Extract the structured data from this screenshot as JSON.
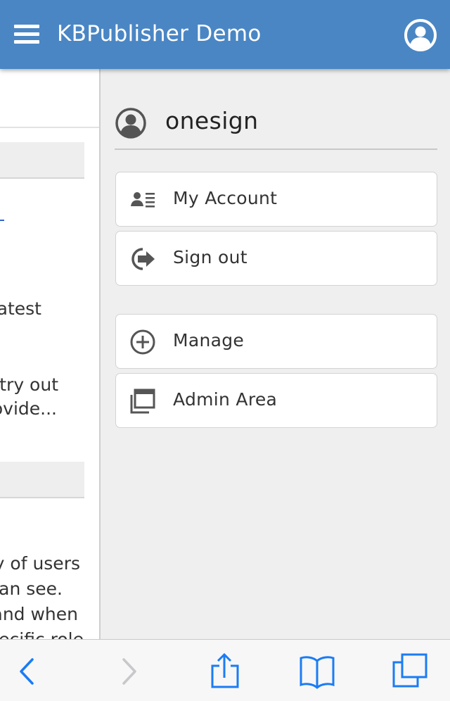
{
  "header": {
    "title": "KBPublisher Demo",
    "accent_color": "#4a86c4"
  },
  "left_content": {
    "lines": [
      "atest",
      "try out",
      "ovide...",
      "y of users",
      "an see.",
      "and when",
      "ecific role"
    ]
  },
  "user_panel": {
    "username": "onesign",
    "menu_groups": [
      [
        {
          "label": "My Account",
          "icon": "contact-card-icon"
        },
        {
          "label": "Sign out",
          "icon": "sign-out-icon"
        }
      ],
      [
        {
          "label": "Manage",
          "icon": "plus-circle-icon"
        },
        {
          "label": "Admin Area",
          "icon": "windows-stack-icon"
        }
      ]
    ]
  },
  "browser_toolbar": {
    "items": [
      {
        "icon": "back-arrow-icon",
        "enabled": true
      },
      {
        "icon": "forward-arrow-icon",
        "enabled": false
      },
      {
        "icon": "share-icon",
        "enabled": true
      },
      {
        "icon": "bookmarks-icon",
        "enabled": true
      },
      {
        "icon": "tabs-icon",
        "enabled": true
      }
    ],
    "tint_color": "#1a7cf5"
  }
}
